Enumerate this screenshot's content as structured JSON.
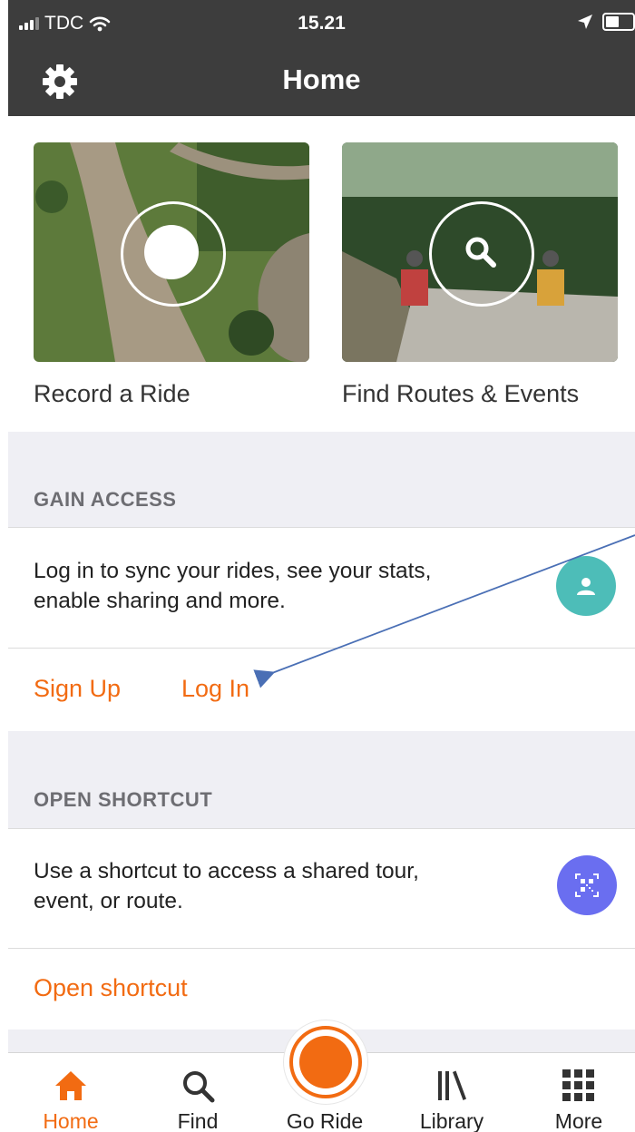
{
  "status_bar": {
    "carrier": "TDC",
    "time": "15.21"
  },
  "nav": {
    "title": "Home"
  },
  "tiles": [
    {
      "label": "Record a Ride",
      "icon": "record-icon"
    },
    {
      "label": "Find Routes & Events",
      "icon": "search-icon"
    }
  ],
  "gain_access": {
    "header": "GAIN ACCESS",
    "description": "Log in to sync your rides, see your stats, enable sharing and more.",
    "sign_up": "Sign Up",
    "log_in": "Log In",
    "icon": "user-icon",
    "icon_color": "#4dbdb8"
  },
  "open_shortcut": {
    "header": "OPEN SHORTCUT",
    "description": "Use a shortcut to access a shared tour, event, or route.",
    "link": "Open shortcut",
    "icon": "qr-code-icon",
    "icon_color": "#6a6ef0"
  },
  "tab_bar": {
    "items": [
      {
        "label": "Home",
        "icon": "home-icon",
        "active": true
      },
      {
        "label": "Find",
        "icon": "search-icon",
        "active": false
      },
      {
        "label": "Go Ride",
        "icon": "record-button-icon",
        "active": false
      },
      {
        "label": "Library",
        "icon": "library-icon",
        "active": false
      },
      {
        "label": "More",
        "icon": "grid-icon",
        "active": false
      }
    ]
  },
  "colors": {
    "accent": "#f26b12",
    "navbar": "#3d3d3d",
    "section_bg": "#efeff4",
    "annotation_arrow": "#4a6fb5"
  }
}
